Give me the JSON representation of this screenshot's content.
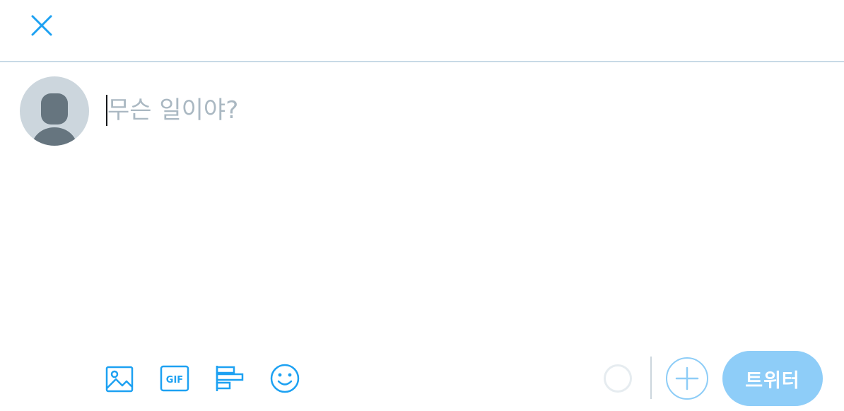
{
  "compose": {
    "placeholder": "무슨 일이야?"
  },
  "toolbar": {
    "gif_label": "GIF"
  },
  "actions": {
    "tweet_label": "트위터"
  },
  "colors": {
    "accent": "#1da1f2",
    "accent_disabled": "#8ecdf8",
    "placeholder_text": "#aab8c2",
    "avatar_bg": "#ccd6dd",
    "avatar_fg": "#66757f",
    "divider": "#c8dae6"
  },
  "icons": {
    "close": "close-icon",
    "media": "image-icon",
    "gif": "gif-icon",
    "poll": "poll-icon",
    "emoji": "emoji-icon",
    "add": "plus-icon"
  }
}
